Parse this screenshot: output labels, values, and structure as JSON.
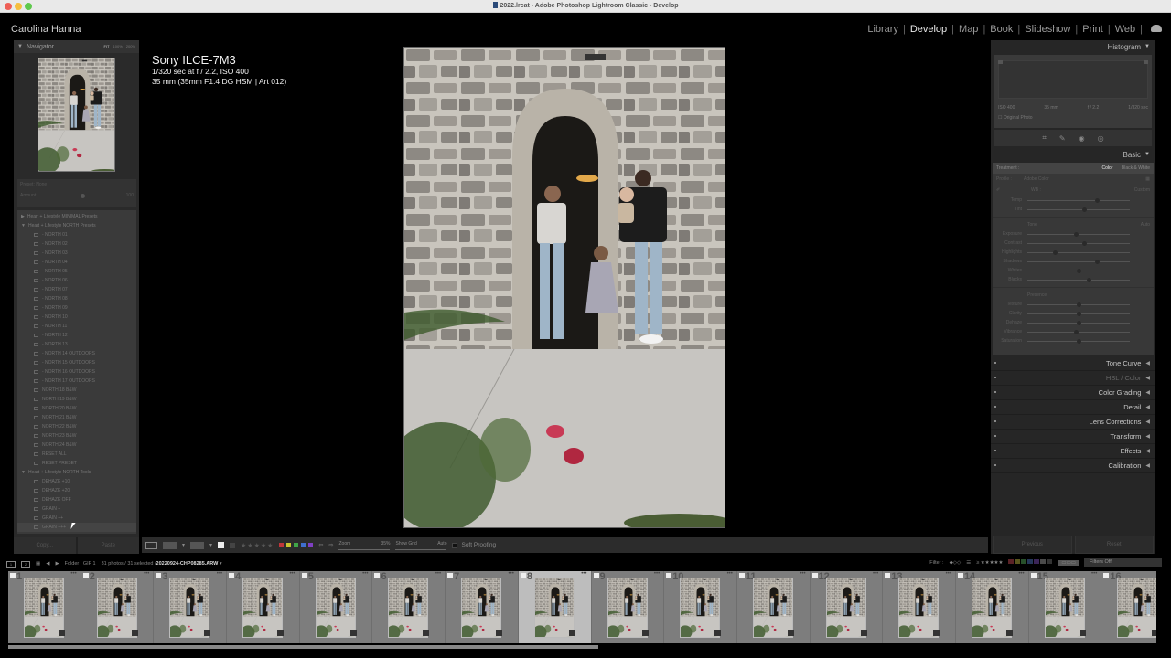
{
  "window": {
    "title": "2022.lrcat - Adobe Photoshop Lightroom Classic - Develop"
  },
  "identity_plate": "Carolina Hanna",
  "modules": [
    {
      "label": "Library",
      "active": false
    },
    {
      "label": "Develop",
      "active": true
    },
    {
      "label": "Map",
      "active": false
    },
    {
      "label": "Book",
      "active": false
    },
    {
      "label": "Slideshow",
      "active": false
    },
    {
      "label": "Print",
      "active": false
    },
    {
      "label": "Web",
      "active": false
    }
  ],
  "left_panel": {
    "navigator": {
      "title": "Navigator",
      "zoom_options": [
        "FIT",
        "100%",
        "200%"
      ],
      "selected_zoom": "FIT"
    },
    "preset_amount": {
      "preset_label": "Preset: None",
      "amount_label": "Amount",
      "amount_value": "100",
      "amount_fraction": 0.5
    },
    "presets": [
      {
        "type": "group",
        "expanded": false,
        "label": "Heart + Lifestyle MINIMAL Presets"
      },
      {
        "type": "group",
        "expanded": true,
        "label": "Heart + Lifestyle NORTH Presets"
      },
      {
        "type": "item",
        "label": "- NORTH 01"
      },
      {
        "type": "item",
        "label": "- NORTH 02"
      },
      {
        "type": "item",
        "label": "- NORTH 03"
      },
      {
        "type": "item",
        "label": "- NORTH 04"
      },
      {
        "type": "item",
        "label": "- NORTH 05"
      },
      {
        "type": "item",
        "label": "- NORTH 06"
      },
      {
        "type": "item",
        "label": "- NORTH 07"
      },
      {
        "type": "item",
        "label": "- NORTH 08"
      },
      {
        "type": "item",
        "label": "- NORTH 09"
      },
      {
        "type": "item",
        "label": "- NORTH 10"
      },
      {
        "type": "item",
        "label": "- NORTH 11"
      },
      {
        "type": "item",
        "label": "- NORTH 12"
      },
      {
        "type": "item",
        "label": "- NORTH 13"
      },
      {
        "type": "item",
        "label": "- NORTH 14 OUTDOORS"
      },
      {
        "type": "item",
        "label": "- NORTH 15 OUTDOORS"
      },
      {
        "type": "item",
        "label": "- NORTH 16 OUTDOORS"
      },
      {
        "type": "item",
        "label": "- NORTH 17 OUTDOORS"
      },
      {
        "type": "item",
        "label": "NORTH 18 B&W"
      },
      {
        "type": "item",
        "label": "NORTH 19 B&W"
      },
      {
        "type": "item",
        "label": "NORTH 20 B&W"
      },
      {
        "type": "item",
        "label": "NORTH 21 B&W"
      },
      {
        "type": "item",
        "label": "NORTH 22 B&W"
      },
      {
        "type": "item",
        "label": "NORTH 23 B&W"
      },
      {
        "type": "item",
        "label": "NORTH 24 B&W"
      },
      {
        "type": "item",
        "label": "RESET ALL"
      },
      {
        "type": "item",
        "label": "RESET PRESET"
      },
      {
        "type": "group",
        "expanded": true,
        "label": "Heart + Lifestyle NORTH Tools"
      },
      {
        "type": "item",
        "label": "DEHAZE +10"
      },
      {
        "type": "item",
        "label": "DEHAZE +20"
      },
      {
        "type": "item",
        "label": "DEHAZE OFF"
      },
      {
        "type": "item",
        "label": "GRAIN +"
      },
      {
        "type": "item",
        "label": "GRAIN ++"
      },
      {
        "type": "item",
        "label": "GRAIN +++",
        "hover": true
      }
    ],
    "copy_label": "Copy...",
    "paste_label": "Paste"
  },
  "photo_info": {
    "camera": "Sony ILCE-7M3",
    "exposure": "1/320 sec at f / 2.2, ISO 400",
    "lens": "35 mm (35mm F1.4 DG HSM | Art 012)"
  },
  "right_panel": {
    "histogram": {
      "title": "Histogram",
      "iso": "ISO 400",
      "focal": "35 mm",
      "aperture": "f / 2.2",
      "shutter": "1/320 sec",
      "original_photo_label": "Original Photo"
    },
    "tools": [
      "crop-icon",
      "healing-icon",
      "redeye-icon",
      "masking-icon"
    ],
    "basic": {
      "title": "Basic",
      "treatment_label": "Treatment :",
      "treatment_options": [
        "Color",
        "Black & White"
      ],
      "treatment_selected": "Color",
      "profile_label": "Profile :",
      "profile_value": "Adobe Color",
      "wb_label": "WB :",
      "wb_value": "Custom",
      "sliders_wb": [
        {
          "label": "Temp",
          "position": 0.68
        },
        {
          "label": "Tint",
          "position": 0.55
        }
      ],
      "tone_label": "Tone",
      "auto_label": "Auto",
      "sliders_tone": [
        {
          "label": "Exposure",
          "position": 0.47
        },
        {
          "label": "Contrast",
          "position": 0.55
        },
        {
          "label": "Highlights",
          "position": 0.27
        },
        {
          "label": "Shadows",
          "position": 0.68
        },
        {
          "label": "Whites",
          "position": 0.5
        },
        {
          "label": "Blacks",
          "position": 0.6
        }
      ],
      "presence_label": "Presence",
      "sliders_presence": [
        {
          "label": "Texture",
          "position": 0.5
        },
        {
          "label": "Clarity",
          "position": 0.5
        },
        {
          "label": "Dehaze",
          "position": 0.5
        },
        {
          "label": "Vibrance",
          "position": 0.47
        },
        {
          "label": "Saturation",
          "position": 0.5
        }
      ]
    },
    "sections": [
      {
        "label": "Tone Curve",
        "dimmed": false
      },
      {
        "label": "HSL / Color",
        "dimmed": true
      },
      {
        "label": "Color Grading",
        "dimmed": false
      },
      {
        "label": "Detail",
        "dimmed": false
      },
      {
        "label": "Lens Corrections",
        "dimmed": false
      },
      {
        "label": "Transform",
        "dimmed": false
      },
      {
        "label": "Effects",
        "dimmed": false
      },
      {
        "label": "Calibration",
        "dimmed": false
      }
    ],
    "previous_label": "Previous",
    "reset_label": "Reset"
  },
  "toolbar": {
    "zoom_label": "Zoom",
    "zoom_value": "35%",
    "show_grid_label": "Show Grid",
    "show_grid_value": "Auto",
    "soft_proofing_label": "Soft Proofing",
    "color_labels": [
      "#c0363a",
      "#c9c430",
      "#3fa648",
      "#3f6fcf",
      "#8040c4"
    ]
  },
  "filmstrip_header": {
    "source": "Folder : GIF 1",
    "count": "31 photos / 31 selected /",
    "filename": "20220924-CHP08285.ARW",
    "filter_label": "Filter :",
    "filters_off": "Filters Off",
    "filter_colors": [
      "#5a2226",
      "#59561e",
      "#27502a",
      "#25375a",
      "#3b2558",
      "#4a4a4a",
      "#333333"
    ]
  },
  "filmstrip": {
    "selected_index": 8,
    "items": [
      1,
      2,
      3,
      4,
      5,
      6,
      7,
      8,
      9,
      10,
      11,
      12,
      13,
      14,
      15,
      16
    ]
  }
}
